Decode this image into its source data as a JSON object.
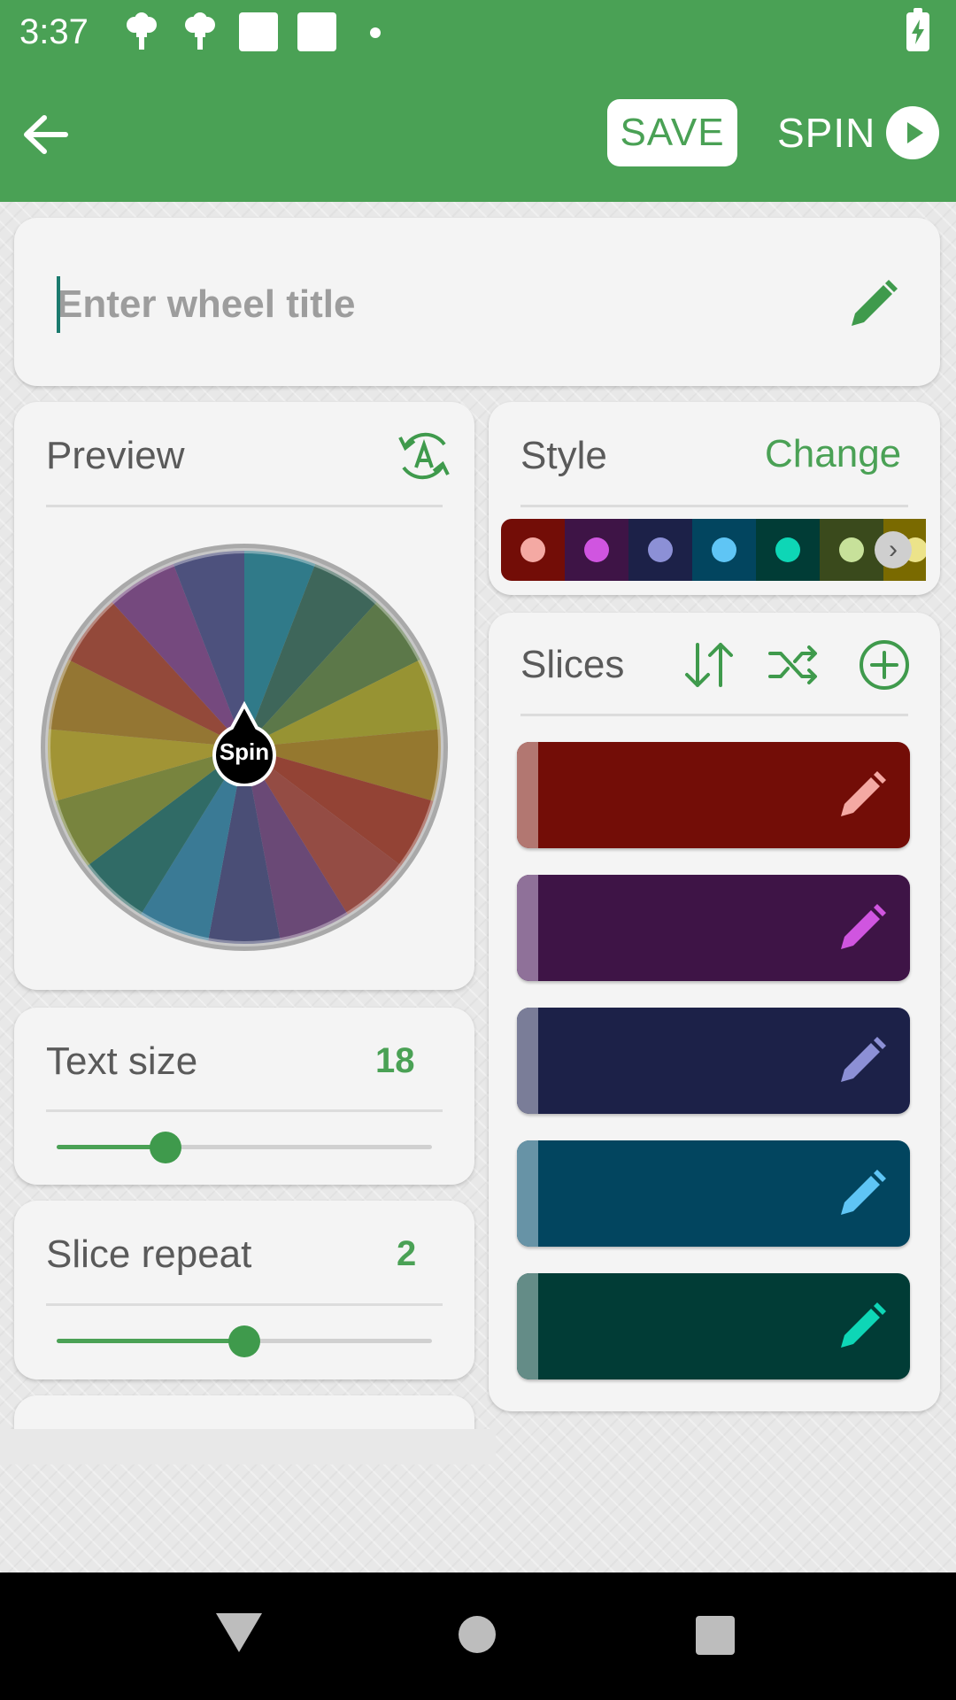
{
  "status_bar": {
    "time": "3:37",
    "icons": [
      "notification-icon",
      "notification-icon",
      "square-icon",
      "square-icon",
      "dot-icon",
      "battery-charging-icon"
    ]
  },
  "toolbar": {
    "back_icon": "arrow-back-icon",
    "save_label": "SAVE",
    "spin_label": "SPIN",
    "spin_icon": "play-circle-icon",
    "accent": "#4aa155"
  },
  "title": {
    "value": "",
    "placeholder": "Enter wheel title",
    "edit_icon": "pencil-icon"
  },
  "preview": {
    "label": "Preview",
    "action_icon": "auto-rotate-text-icon",
    "wheel_center_label": "Spin",
    "wheel_colors": [
      "#1f6f7f",
      "#2e5a4c",
      "#4f6d3a",
      "#8f8a22",
      "#8c6d1e",
      "#8a3324",
      "#8b3d35",
      "#5e3a6b",
      "#3b3f6b",
      "#2a6f8c",
      "#1f5f5a",
      "#6d7a2e",
      "#9a8b24",
      "#8b6b22",
      "#8a3a2a",
      "#6a3a73",
      "#3e4372"
    ]
  },
  "text_size": {
    "label": "Text size",
    "value": "18",
    "slider_fraction": 0.29
  },
  "slice_repeat": {
    "label": "Slice repeat",
    "value": "2",
    "slider_fraction": 0.5
  },
  "style": {
    "label": "Style",
    "change_label": "Change",
    "palette": [
      {
        "bg": "#730d07",
        "dot": "#f4a9a3"
      },
      {
        "bg": "#3e1446",
        "dot": "#d055e0"
      },
      {
        "bg": "#1c2148",
        "dot": "#8c90d6"
      },
      {
        "bg": "#02455f",
        "dot": "#5fc5f5"
      },
      {
        "bg": "#013c36",
        "dot": "#0ed6b6"
      },
      {
        "bg": "#3a4a1c",
        "dot": "#c7e19a"
      },
      {
        "bg": "#7a6a00",
        "dot": "#ece38a"
      }
    ],
    "next_icon": "chevron-right-icon"
  },
  "slices": {
    "label": "Slices",
    "action_icons": [
      "sort-icon",
      "shuffle-icon",
      "add-circle-icon"
    ],
    "items": [
      {
        "bg": "#730d07",
        "bar": "#b27771",
        "pencil": "#f4a9a3"
      },
      {
        "bg": "#3e1446",
        "bar": "#8f7199",
        "pencil": "#d055e0"
      },
      {
        "bg": "#1c2148",
        "bar": "#7a7d98",
        "pencil": "#8c90d6"
      },
      {
        "bg": "#02455f",
        "bar": "#6793a6",
        "pencil": "#5fc5f5"
      },
      {
        "bg": "#013c36",
        "bar": "#648c87",
        "pencil": "#0ed6b6"
      }
    ]
  },
  "navigation": {
    "icons": [
      "nav-back-icon",
      "nav-home-icon",
      "nav-recents-icon"
    ]
  }
}
